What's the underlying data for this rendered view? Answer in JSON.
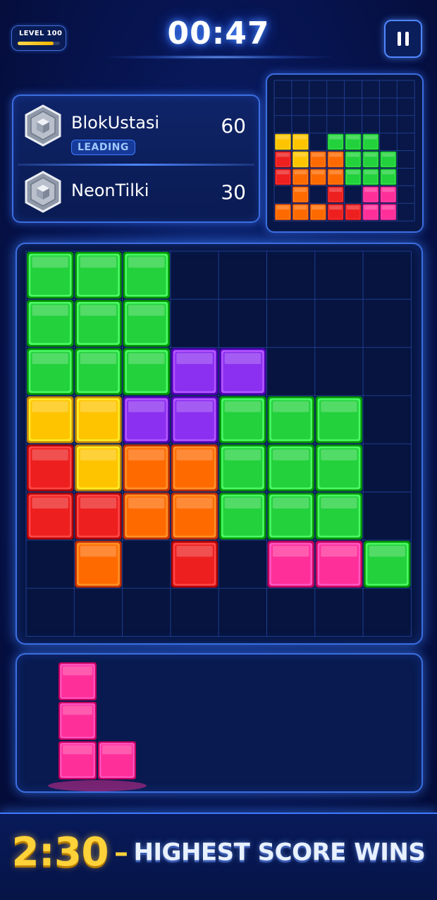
{
  "hud": {
    "level_label": "LEVEL 100",
    "level_progress": 0.85,
    "timer": "00:47"
  },
  "players": [
    {
      "name": "BlokUstasi",
      "score": "60",
      "badge": "LEADING"
    },
    {
      "name": "NeonTilki",
      "score": "30"
    }
  ],
  "icons": {
    "pause": "pause-icon",
    "avatar": "hexagon-cube-avatar-icon"
  },
  "colors": {
    "accent": "#3c6ee0",
    "gold": "#ffd23a",
    "green": "#22d13c",
    "yellow": "#ffc400",
    "purple": "#8b2ff0",
    "red": "#ee1f1f",
    "orange": "#ff6a00",
    "pink": "#ff2f9a"
  },
  "mini_board": {
    "cols": 7,
    "rows": 8,
    "cells": [
      "........",
      "YY.GGG.",
      "RYOOGGG",
      "ROOOGGG",
      ".O.R.PP",
      "OOORRPP"
    ]
  },
  "board": {
    "cols": 8,
    "rows": 8,
    "cells": [
      "GGG.....",
      "GGG.....",
      "GGGPP...",
      "YYPPGGG.",
      "RYOOGGG.",
      "RROOGGG.",
      ".O.R.PPG",
      "........"
    ]
  },
  "tray": {
    "piece": [
      "P.",
      "P.",
      "PP"
    ],
    "piece_color": "pink"
  },
  "banner": {
    "time": "2:30",
    "dash": "–",
    "text": "HIGHEST SCORE WINS"
  }
}
